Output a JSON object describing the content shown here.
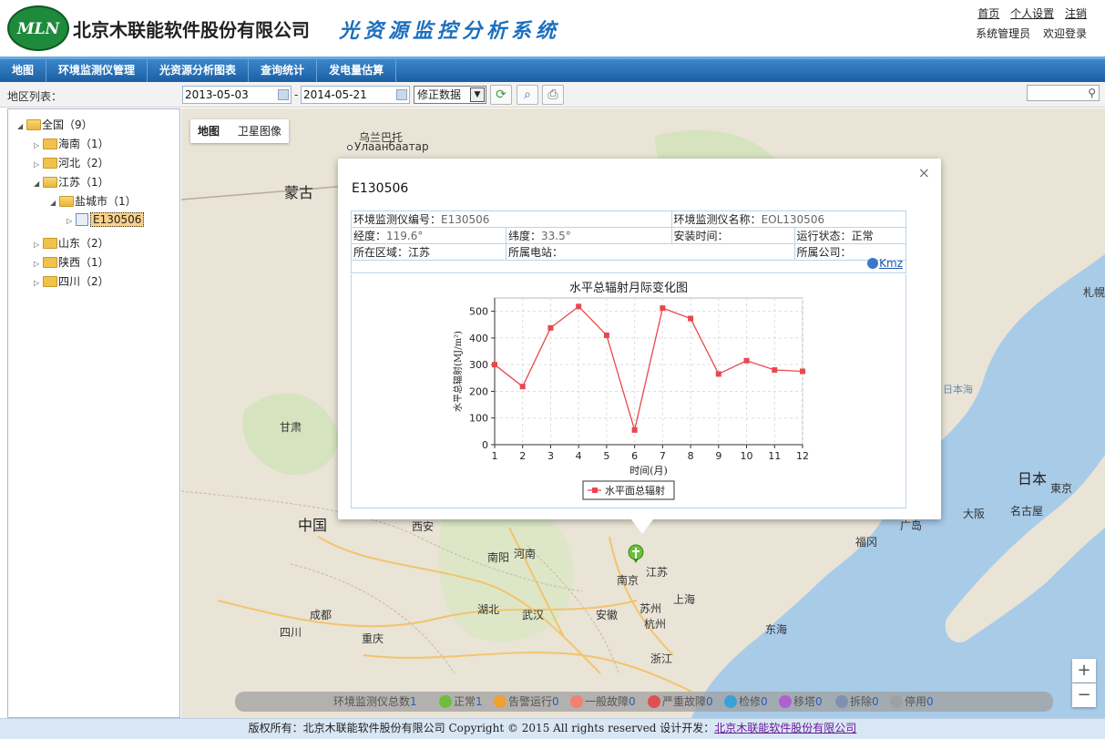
{
  "header": {
    "logo_text": "MLN",
    "company": "北京木联能软件股份有限公司",
    "system_name": "光资源监控分析系统",
    "links": [
      "首页",
      "个人设置",
      "注销"
    ],
    "user_role": "系统管理员",
    "welcome": "欢迎登录"
  },
  "nav": [
    "地图",
    "环境监测仪管理",
    "光资源分析图表",
    "查询统计",
    "发电量估算"
  ],
  "toolbar": {
    "region_label": "地区列表：",
    "start_date": "2013-05-03",
    "dash": "-",
    "end_date": "2014-05-21",
    "data_mode": "修正数据",
    "search_value": ""
  },
  "tree": [
    {
      "label": "全国（9）",
      "level": 0,
      "expanded": true
    },
    {
      "label": "海南（1）",
      "level": 1
    },
    {
      "label": "河北（2）",
      "level": 1
    },
    {
      "label": "江苏（1）",
      "level": 1,
      "expanded": true
    },
    {
      "label": "盐城市（1）",
      "level": 2,
      "expanded": true
    },
    {
      "label": "E130506",
      "level": 3,
      "selected": true
    },
    {
      "label": "山东（2）",
      "level": 1
    },
    {
      "label": "陕西（1）",
      "level": 1
    },
    {
      "label": "四川（2）",
      "level": 1
    }
  ],
  "map": {
    "tabs": [
      "地图",
      "卫星图像"
    ],
    "labels": {
      "ulaanbaatar": "乌兰巴托",
      "ulaanbaatar_cyr": "Улаанбаатар",
      "mongolia": "蒙古",
      "gansu": "甘肃",
      "china": "中国",
      "xian": "西安",
      "nanyang": "南阳",
      "henan": "河南",
      "nanjing": "南京",
      "jiangsu": "江苏",
      "hubei": "湖北",
      "wuhan": "武汉",
      "anhui": "安徽",
      "suzhou": "苏州",
      "shanghai": "上海",
      "hangzhou": "杭州",
      "chengdu": "成都",
      "sichuan": "四川",
      "chongqing": "重庆",
      "zhejiang": "浙江",
      "donghai": "东海",
      "fukuoka": "福冈",
      "hiroshima": "广岛",
      "osaka": "大阪",
      "nagoya": "名古屋",
      "japan": "日本",
      "tokyo": "東京",
      "sea_of_japan": "日本海",
      "sapporo": "札幌"
    },
    "zoom_in": "+",
    "zoom_out": "−"
  },
  "popup": {
    "title": "E130506",
    "close": "×",
    "rows": [
      [
        "环境监测仪编号：",
        "E130506",
        "环境监测仪名称：",
        "EOL130506"
      ],
      [
        "经度：",
        "119.6°",
        "纬度：",
        "33.5°",
        "安装时间：",
        "",
        "运行状态：",
        "正常"
      ],
      [
        "所在区域：",
        "江苏",
        "所属电站：",
        "",
        "所属公司：",
        ""
      ]
    ],
    "kmz": "Kmz"
  },
  "chart_data": {
    "type": "line",
    "title": "水平总辐射月际变化图",
    "xlabel": "时间(月)",
    "ylabel": "水平总辐射(MJ/m²)",
    "x": [
      1,
      2,
      3,
      4,
      5,
      6,
      7,
      8,
      9,
      10,
      11,
      12
    ],
    "series": [
      {
        "name": "水平面总辐射",
        "values": [
          300,
          218,
          438,
          518,
          410,
          55,
          512,
          473,
          265,
          315,
          280,
          275
        ]
      }
    ],
    "ylim": [
      0,
      550
    ],
    "yticks": [
      0,
      100,
      200,
      300,
      400,
      500
    ],
    "grid": true,
    "legend": "bottom",
    "color": "#e8484f"
  },
  "status": {
    "total_label": "环境监测仪总数",
    "total": "1",
    "items": [
      {
        "label": "正常",
        "count": "1",
        "color": "#6cbf3a"
      },
      {
        "label": "告警运行",
        "count": "0",
        "color": "#f0a030"
      },
      {
        "label": "一般故障",
        "count": "0",
        "color": "#f08070"
      },
      {
        "label": "严重故障",
        "count": "0",
        "color": "#e05050"
      },
      {
        "label": "检修",
        "count": "0",
        "color": "#3aa0d8"
      },
      {
        "label": "移塔",
        "count": "0",
        "color": "#b060d0"
      },
      {
        "label": "拆除",
        "count": "0",
        "color": "#8090b0"
      },
      {
        "label": "停用",
        "count": "0",
        "color": "#a0a0a0"
      }
    ]
  },
  "footer": {
    "text": "版权所有：北京木联能软件股份有限公司 Copyright © 2015 All rights reserved 设计开发：",
    "link": "北京木联能软件股份有限公司"
  }
}
